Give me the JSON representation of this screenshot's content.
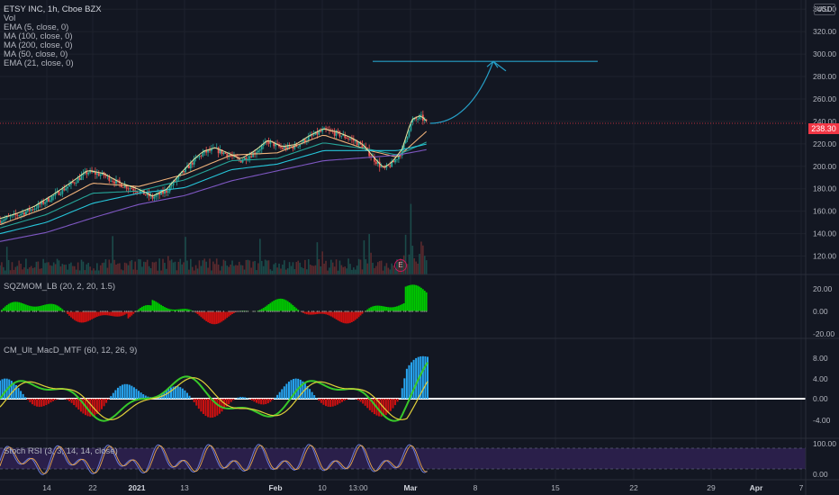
{
  "header": {
    "symbol": "ETSY INC, 1h, Cboe BZX",
    "indicators": [
      "Vol",
      "EMA (5, close, 0)",
      "MA (100, close, 0)",
      "MA (200, close, 0)",
      "MA (50, close, 0)",
      "EMA (21, close, 0)"
    ]
  },
  "currency": "USD",
  "last_price": "238.30",
  "earnings_marker": "E",
  "panes": {
    "momentum": {
      "label": "SQZMOM_LB (20, 2, 20, 1.5)",
      "ticks": [
        "20.00",
        "0.00",
        "-20.00"
      ]
    },
    "macd": {
      "label": "CM_Ult_MacD_MTF (60, 12, 26, 9)",
      "ticks": [
        "8.00",
        "4.00",
        "0.00",
        "-4.00"
      ]
    },
    "stoch": {
      "label": "Stoch RSI (3, 3, 14, 14, close)",
      "ticks": [
        "100.00",
        "0.00"
      ]
    }
  },
  "colors": {
    "background": "#131722",
    "price_tag": "#f23645",
    "drawing": "#26a0c8",
    "ema5": "#e6e6a0",
    "ma100": "#26c6da",
    "ma200": "#7e57c2",
    "ma50": "#26a69a",
    "ema21": "#f0b27a",
    "bull": "#26a69a",
    "bear": "#ef5350"
  },
  "chart_data": {
    "type": "line",
    "title": "ETSY INC, 1h, Cboe BZX",
    "y_ticks": [
      120,
      140,
      160,
      180,
      200,
      220,
      240,
      260,
      280,
      300,
      320,
      340
    ],
    "ylim": [
      110,
      345
    ],
    "x_ticks": [
      "14",
      "22",
      "2021",
      "13",
      "Feb",
      "10",
      "13:00",
      "Mar",
      "8",
      "15",
      "22",
      "29",
      "Apr",
      "7"
    ],
    "last_price": 238.3,
    "price_path": [
      [
        0,
        152
      ],
      [
        8,
        157
      ],
      [
        15,
        163
      ],
      [
        22,
        172
      ],
      [
        30,
        183
      ],
      [
        38,
        195
      ],
      [
        45,
        192
      ],
      [
        52,
        184
      ],
      [
        60,
        178
      ],
      [
        66,
        172
      ],
      [
        72,
        178
      ],
      [
        78,
        192
      ],
      [
        84,
        205
      ],
      [
        88,
        212
      ],
      [
        93,
        215
      ],
      [
        98,
        211
      ],
      [
        104,
        205
      ],
      [
        110,
        212
      ],
      [
        116,
        222
      ],
      [
        122,
        216
      ],
      [
        128,
        218
      ],
      [
        134,
        226
      ],
      [
        140,
        232
      ],
      [
        146,
        229
      ],
      [
        152,
        224
      ],
      [
        157,
        218
      ],
      [
        162,
        206
      ],
      [
        166,
        197
      ],
      [
        170,
        203
      ],
      [
        174,
        214
      ],
      [
        178,
        240
      ],
      [
        182,
        244
      ],
      [
        185,
        238
      ]
    ],
    "ema21_path": [
      [
        0,
        148
      ],
      [
        20,
        163
      ],
      [
        40,
        185
      ],
      [
        60,
        182
      ],
      [
        80,
        193
      ],
      [
        100,
        210
      ],
      [
        120,
        212
      ],
      [
        140,
        228
      ],
      [
        160,
        214
      ],
      [
        172,
        208
      ],
      [
        185,
        232
      ]
    ],
    "ma50_path": [
      [
        0,
        145
      ],
      [
        20,
        157
      ],
      [
        40,
        176
      ],
      [
        60,
        178
      ],
      [
        80,
        188
      ],
      [
        100,
        205
      ],
      [
        120,
        207
      ],
      [
        140,
        221
      ],
      [
        160,
        215
      ],
      [
        172,
        210
      ],
      [
        185,
        222
      ]
    ],
    "ma100_path": [
      [
        0,
        140
      ],
      [
        20,
        150
      ],
      [
        40,
        167
      ],
      [
        60,
        176
      ],
      [
        80,
        181
      ],
      [
        100,
        197
      ],
      [
        120,
        202
      ],
      [
        140,
        214
      ],
      [
        160,
        214
      ],
      [
        172,
        214
      ],
      [
        185,
        220
      ]
    ],
    "ma200_path": [
      [
        0,
        133
      ],
      [
        20,
        141
      ],
      [
        40,
        154
      ],
      [
        60,
        166
      ],
      [
        80,
        174
      ],
      [
        100,
        187
      ],
      [
        120,
        196
      ],
      [
        140,
        205
      ],
      [
        160,
        208
      ],
      [
        172,
        210
      ],
      [
        185,
        215
      ]
    ],
    "projection_target": 293.5
  }
}
